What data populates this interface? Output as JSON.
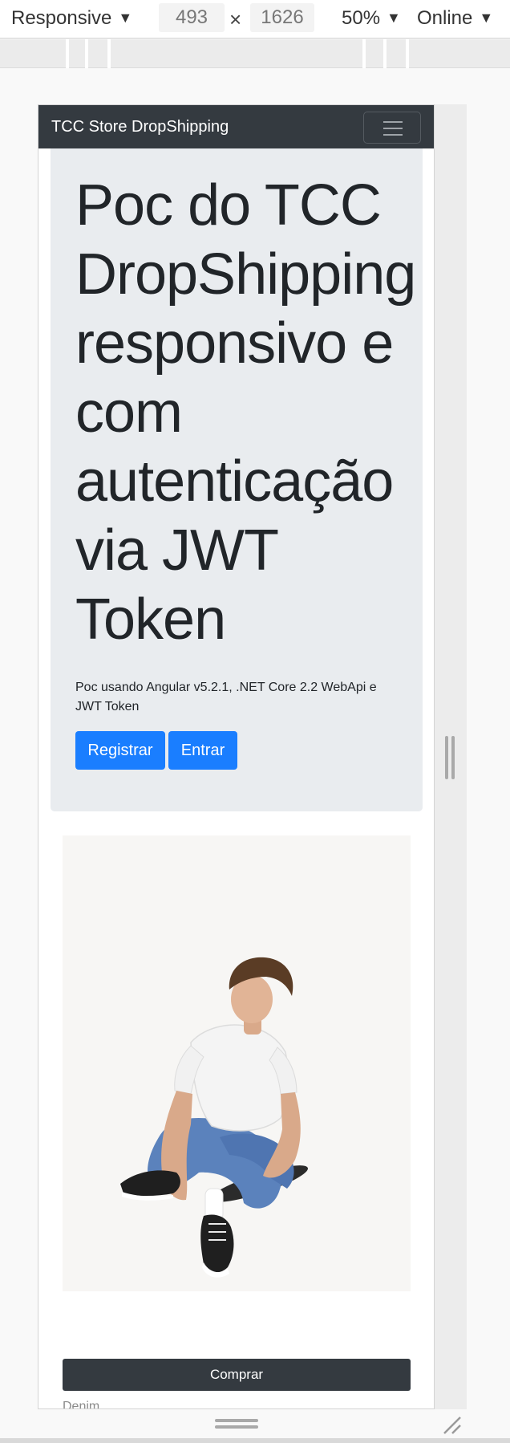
{
  "devtools": {
    "device_mode": "Responsive",
    "width": "493",
    "times": "×",
    "height": "1626",
    "zoom": "50%",
    "throttling": "Online",
    "caret": "▼"
  },
  "site": {
    "brand": "TCC Store DropShipping",
    "jumbotron": {
      "title": "Poc do TCC DropShipping responsivo e com autenticação via JWT Token",
      "lead": "Poc usando Angular v5.2.1, .NET Core 2.2 WebApi e JWT Token",
      "register_label": "Registrar",
      "login_label": "Entrar"
    },
    "product": {
      "buy_label": "Comprar",
      "name": "Denim"
    }
  },
  "colors": {
    "navbar": "#343a40",
    "primary": "#1a7eff",
    "jumbotron": "#e9ecef",
    "buy_button": "#343a40"
  },
  "icons": [
    "menu-icon",
    "dropdown-caret-icon",
    "resize-grip-icon"
  ]
}
